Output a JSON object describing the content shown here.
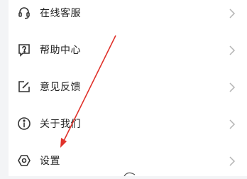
{
  "menu": {
    "items": [
      {
        "label": "在线客服",
        "icon": "headset-icon"
      },
      {
        "label": "帮助中心",
        "icon": "help-question-icon"
      },
      {
        "label": "意见反馈",
        "icon": "edit-feedback-icon"
      },
      {
        "label": "关于我们",
        "icon": "info-icon"
      },
      {
        "label": "设置",
        "icon": "settings-hex-icon"
      }
    ]
  },
  "colors": {
    "annotation_arrow": "#e0322b",
    "text": "#222222",
    "chevron": "#b5b5b5",
    "background": "#f3f4f6"
  }
}
